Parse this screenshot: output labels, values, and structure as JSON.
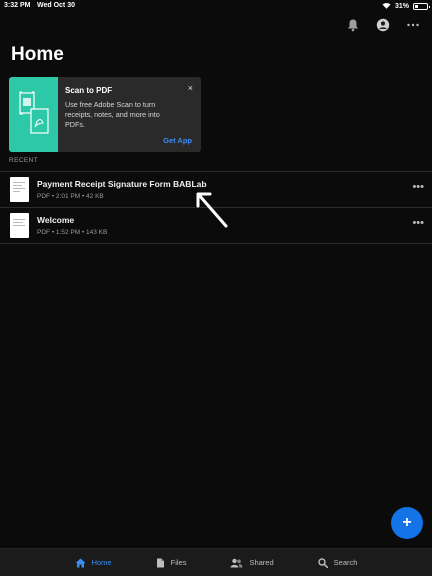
{
  "status_bar": {
    "time": "3:32 PM",
    "date": "Wed Oct 30",
    "battery_percent": "31%",
    "battery_level": 0.31
  },
  "header": {
    "title": "Home",
    "icons": [
      "bell-icon",
      "account-icon",
      "more-icon"
    ]
  },
  "promo": {
    "title": "Scan to PDF",
    "body": "Use free Adobe Scan to turn receipts, notes, and more into PDFs.",
    "close_label": "×",
    "cta_label": "Get App",
    "accent_color": "#2dc8a8"
  },
  "recent": {
    "label": "RECENT",
    "files": [
      {
        "name": "Payment Receipt Signature Form BABLab",
        "type": "PDF",
        "time": "2:01 PM",
        "size": "42 KB"
      },
      {
        "name": "Welcome",
        "type": "PDF",
        "time": "1:52 PM",
        "size": "143 KB"
      }
    ]
  },
  "fab": {
    "label": "+"
  },
  "tab_bar": {
    "tabs": [
      {
        "label": "Home",
        "icon": "home-icon",
        "active": true
      },
      {
        "label": "Files",
        "icon": "files-icon",
        "active": false
      },
      {
        "label": "Shared",
        "icon": "shared-icon",
        "active": false
      },
      {
        "label": "Search",
        "icon": "search-icon",
        "active": false
      }
    ]
  },
  "colors": {
    "background": "#0b0b0b",
    "accent": "#1473e6",
    "link": "#3b8cf0"
  }
}
